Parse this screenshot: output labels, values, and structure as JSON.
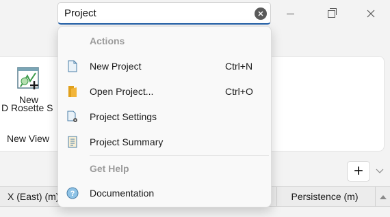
{
  "search": {
    "value": "Project"
  },
  "window_controls": {
    "minimize_icon": "minimize-icon",
    "maximize_icon": "restore-icon",
    "close_icon": "close-icon"
  },
  "ribbon": {
    "button_line1": "New",
    "button_line2": "D  Rosette  S",
    "group_label": "New View",
    "icon": "rosette-icon"
  },
  "dropdown": {
    "sections": [
      {
        "header": "Actions",
        "items": [
          {
            "label": "New Project",
            "shortcut": "Ctrl+N",
            "icon": "new-document-icon"
          },
          {
            "label": "Open Project...",
            "shortcut": "Ctrl+O",
            "icon": "open-folder-icon"
          },
          {
            "label": "Project Settings",
            "shortcut": "",
            "icon": "document-settings-icon"
          },
          {
            "label": "Project Summary",
            "shortcut": "",
            "icon": "summary-icon"
          }
        ]
      },
      {
        "header": "Get Help",
        "items": [
          {
            "label": "Documentation",
            "shortcut": "",
            "icon": "help-icon"
          }
        ]
      }
    ]
  },
  "toolbar": {
    "add_label": "+"
  },
  "table": {
    "columns": [
      "X (East) (m)",
      "Persistence (m)"
    ]
  },
  "colors": {
    "accent": "#1f5ea8",
    "background": "#f3f3f3",
    "section_header": "#9a9a9a"
  }
}
